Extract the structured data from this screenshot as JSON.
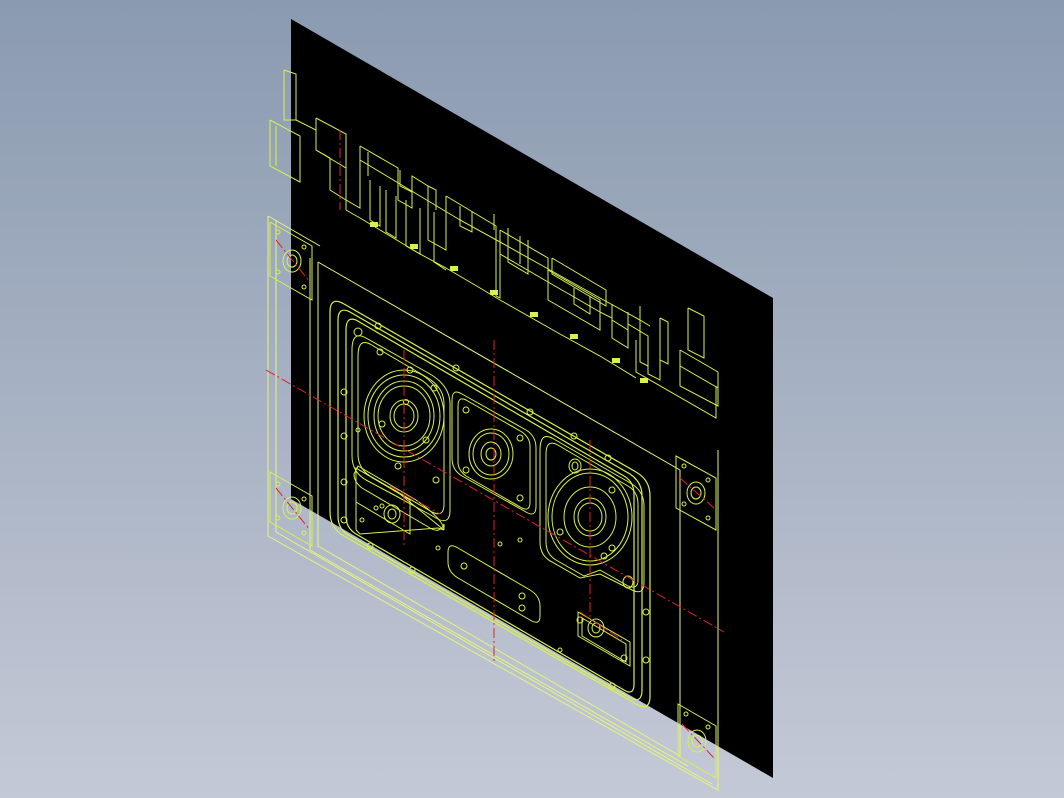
{
  "viewport": {
    "background_top": "#8A9AB0",
    "background_bottom": "#C4C9D6"
  },
  "drawing": {
    "sheet_color": "#000000",
    "line_color": "#D8F050",
    "frame_color": "#E6F57A",
    "centerline_color": "#E0202A",
    "view_style": "isometric wireframe CAD model (mold plate assembly)"
  }
}
